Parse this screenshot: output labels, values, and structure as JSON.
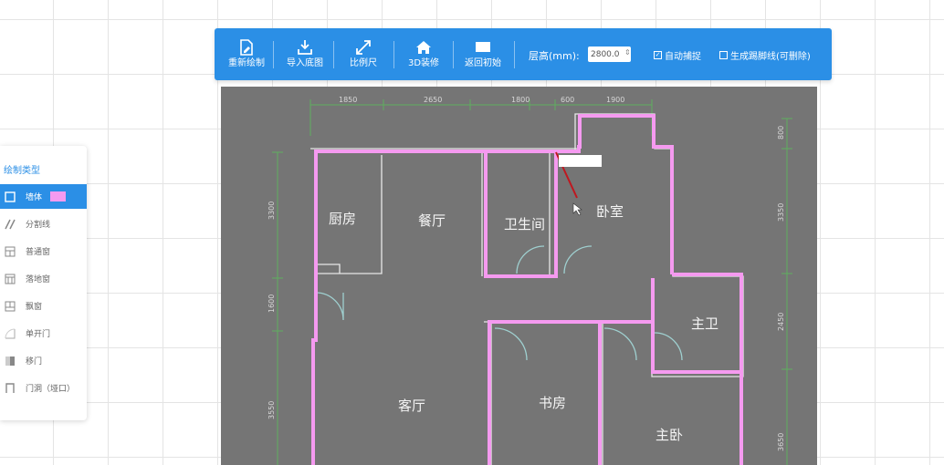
{
  "toolbar": {
    "buttons": [
      {
        "label": "重新绘制",
        "icon": "redraw-icon"
      },
      {
        "label": "导入底图",
        "icon": "import-icon"
      },
      {
        "label": "比例尺",
        "icon": "scale-icon"
      },
      {
        "label": "3D装修",
        "icon": "home-icon"
      },
      {
        "label": "返回初始",
        "icon": "reset-icon"
      }
    ],
    "floor_height_label": "层高(mm):",
    "floor_height_value": "2800.0",
    "auto_snap_label": "自动捕捉",
    "auto_snap_checked": true,
    "baseboard_label": "生成踢脚线(可删除)",
    "baseboard_checked": false
  },
  "panel": {
    "title": "绘制类型",
    "tools": [
      {
        "label": "墙体",
        "icon": "wall-icon",
        "active": true,
        "swatch": "#f59af0"
      },
      {
        "label": "分割线",
        "icon": "divider-line-icon",
        "active": false
      },
      {
        "label": "普通窗",
        "icon": "window-icon",
        "active": false
      },
      {
        "label": "落地窗",
        "icon": "floor-window-icon",
        "active": false
      },
      {
        "label": "飘窗",
        "icon": "bay-window-icon",
        "active": false
      },
      {
        "label": "单开门",
        "icon": "single-door-icon",
        "active": false
      },
      {
        "label": "移门",
        "icon": "sliding-door-icon",
        "active": false
      },
      {
        "label": "门洞（垭口）",
        "icon": "doorway-icon",
        "active": false
      }
    ]
  },
  "plan": {
    "rooms": {
      "kitchen": "厨房",
      "dining": "餐厅",
      "bathroom": "卫生间",
      "bedroom": "卧室",
      "master_bath": "主卫",
      "living": "客厅",
      "study": "书房",
      "master_bedroom": "主卧"
    },
    "top_dims": [
      "1850",
      "2650",
      "1800",
      "600",
      "1900"
    ],
    "left_dims": [
      "3300",
      "1600",
      "3550"
    ],
    "right_dims": [
      "800",
      "3350",
      "2450",
      "3650"
    ],
    "wall_color": "#f59af0"
  },
  "colors": {
    "accent": "#2b8fe6",
    "canvas": "#757575"
  }
}
